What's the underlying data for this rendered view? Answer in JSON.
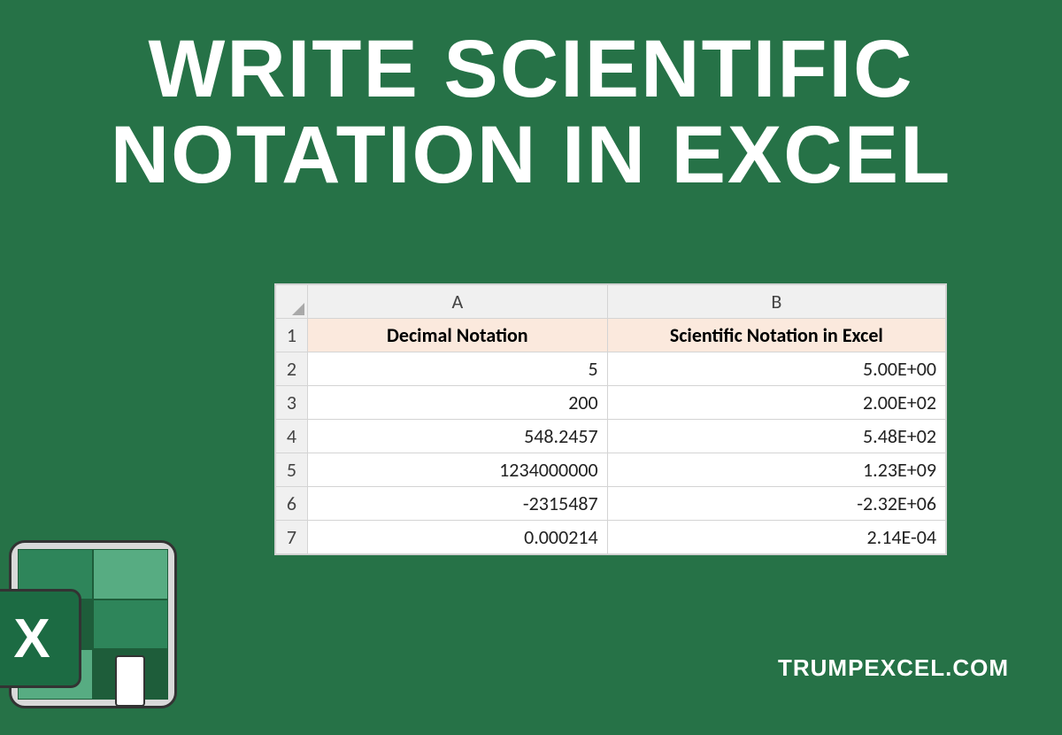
{
  "title_line1": "WRITE SCIENTIFIC",
  "title_line2": "NOTATION IN EXCEL",
  "brand": "TRUMPEXCEL.COM",
  "excel_badge_letter": "X",
  "sheet": {
    "col_letters": [
      "A",
      "B"
    ],
    "row_numbers": [
      "1",
      "2",
      "3",
      "4",
      "5",
      "6",
      "7"
    ],
    "headers": {
      "A": "Decimal Notation",
      "B": "Scientific Notation in Excel"
    },
    "rows": [
      {
        "A": "5",
        "B": "5.00E+00"
      },
      {
        "A": "200",
        "B": "2.00E+02"
      },
      {
        "A": "548.2457",
        "B": "5.48E+02"
      },
      {
        "A": "1234000000",
        "B": "1.23E+09"
      },
      {
        "A": "-2315487",
        "B": "-2.32E+06"
      },
      {
        "A": "0.000214",
        "B": "2.14E-04"
      }
    ]
  },
  "chart_data": {
    "type": "table",
    "title": "Write Scientific Notation in Excel",
    "columns": [
      "Decimal Notation",
      "Scientific Notation in Excel"
    ],
    "rows": [
      [
        5,
        "5.00E+00"
      ],
      [
        200,
        "2.00E+02"
      ],
      [
        548.2457,
        "5.48E+02"
      ],
      [
        1234000000,
        "1.23E+09"
      ],
      [
        -2315487,
        "-2.32E+06"
      ],
      [
        0.000214,
        "2.14E-04"
      ]
    ]
  }
}
